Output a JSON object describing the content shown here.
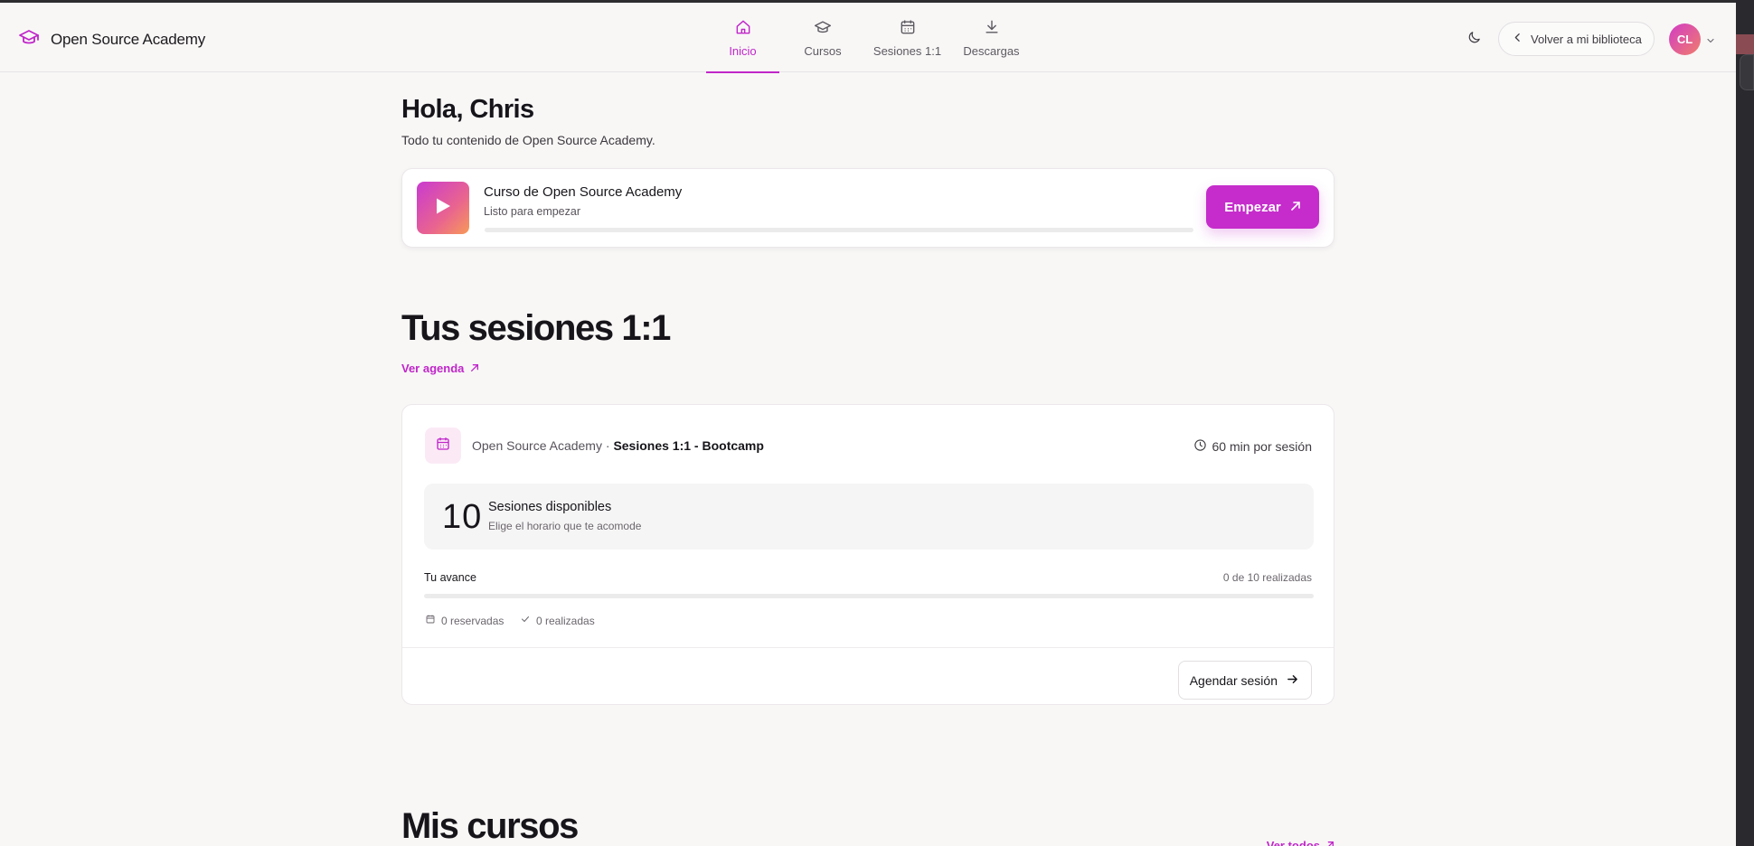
{
  "app": {
    "brand_name": "Open Source Academy",
    "accent_color": "#c026c9"
  },
  "nav": {
    "items": [
      {
        "label": "Inicio",
        "icon": "home-icon",
        "active": true
      },
      {
        "label": "Cursos",
        "icon": "graduation-cap-icon",
        "active": false
      },
      {
        "label": "Sesiones 1:1",
        "icon": "calendar-icon",
        "active": false
      },
      {
        "label": "Descargas",
        "icon": "download-icon",
        "active": false
      }
    ]
  },
  "header": {
    "theme_toggle_icon": "moon-icon",
    "back_label": "Volver a mi biblioteca",
    "avatar_initials": "CL"
  },
  "welcome": {
    "title": "Hola, Chris",
    "subtitle": "Todo tu contenido de Open Source Academy."
  },
  "featured_course": {
    "title": "Curso de Open Source Academy",
    "status": "Listo para empezar",
    "progress_percent": 0,
    "button_label": "Empezar"
  },
  "sessions_section": {
    "title": "Tus sesiones 1:1",
    "agenda_link": "Ver agenda",
    "card": {
      "organization": "Open Source Academy",
      "separator": " · ",
      "program": "Sesiones 1:1 - Bootcamp",
      "duration": "60 min por sesión",
      "available_count": "10",
      "available_label": "Sesiones disponibles",
      "available_hint": "Elige el horario que te acomode",
      "progress_label": "Tu avance",
      "progress_count": "0 de 10 realizadas",
      "progress_percent": 0,
      "reserved": "0 reservadas",
      "completed": "0 realizadas",
      "schedule_button": "Agendar sesión"
    }
  },
  "courses_section": {
    "title": "Mis cursos",
    "see_all": "Ver todos"
  }
}
